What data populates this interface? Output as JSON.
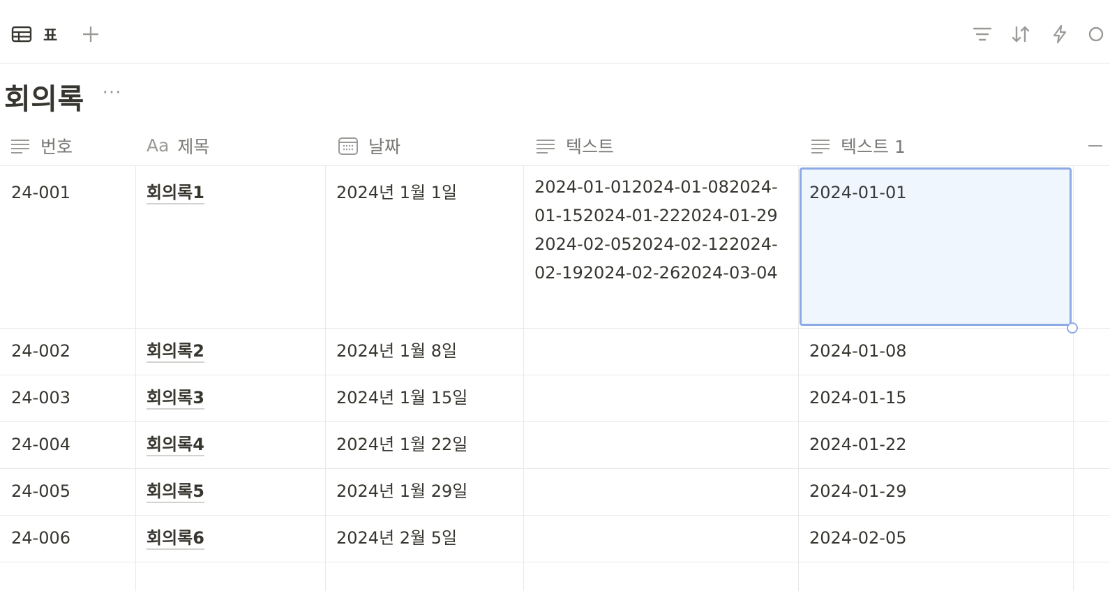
{
  "toolbar": {
    "view_tab_label": "표",
    "icons": [
      "table-icon",
      "plus-icon",
      "filter-icon",
      "sort-icon",
      "automation-icon",
      "search-icon"
    ]
  },
  "database": {
    "title": "회의록",
    "more_label": "···"
  },
  "columns": [
    {
      "label": "번호",
      "icon": "text-lines-icon"
    },
    {
      "label": "제목",
      "icon": "title-aa-icon",
      "prefix": "Aa"
    },
    {
      "label": "날짜",
      "icon": "calendar-icon"
    },
    {
      "label": "텍스트",
      "icon": "text-lines-icon"
    },
    {
      "label": "텍스트 1",
      "icon": "text-lines-icon"
    }
  ],
  "rows": [
    {
      "number": "24-001",
      "title": "회의록1",
      "date": "2024년 1월 1일",
      "text": "2024-01-012024-01-082024-01-152024-01-222024-01-292024-02-052024-02-122024-02-192024-02-262024-03-04",
      "text1": "2024-01-01"
    },
    {
      "number": "24-002",
      "title": "회의록2",
      "date": "2024년 1월 8일",
      "text": "",
      "text1": "2024-01-08"
    },
    {
      "number": "24-003",
      "title": "회의록3",
      "date": "2024년 1월 15일",
      "text": "",
      "text1": "2024-01-15"
    },
    {
      "number": "24-004",
      "title": "회의록4",
      "date": "2024년 1월 22일",
      "text": "",
      "text1": "2024-01-22"
    },
    {
      "number": "24-005",
      "title": "회의록5",
      "date": "2024년 1월 29일",
      "text": "",
      "text1": "2024-01-29"
    },
    {
      "number": "24-006",
      "title": "회의록6",
      "date": "2024년 2월 5일",
      "text": "",
      "text1": "2024-02-05"
    }
  ],
  "selection": {
    "cell_label": "2024-01-01"
  },
  "colors": {
    "selection_border": "#8eaae6",
    "text": "#37352f",
    "muted": "#787774",
    "divider": "#e9e9e7"
  }
}
